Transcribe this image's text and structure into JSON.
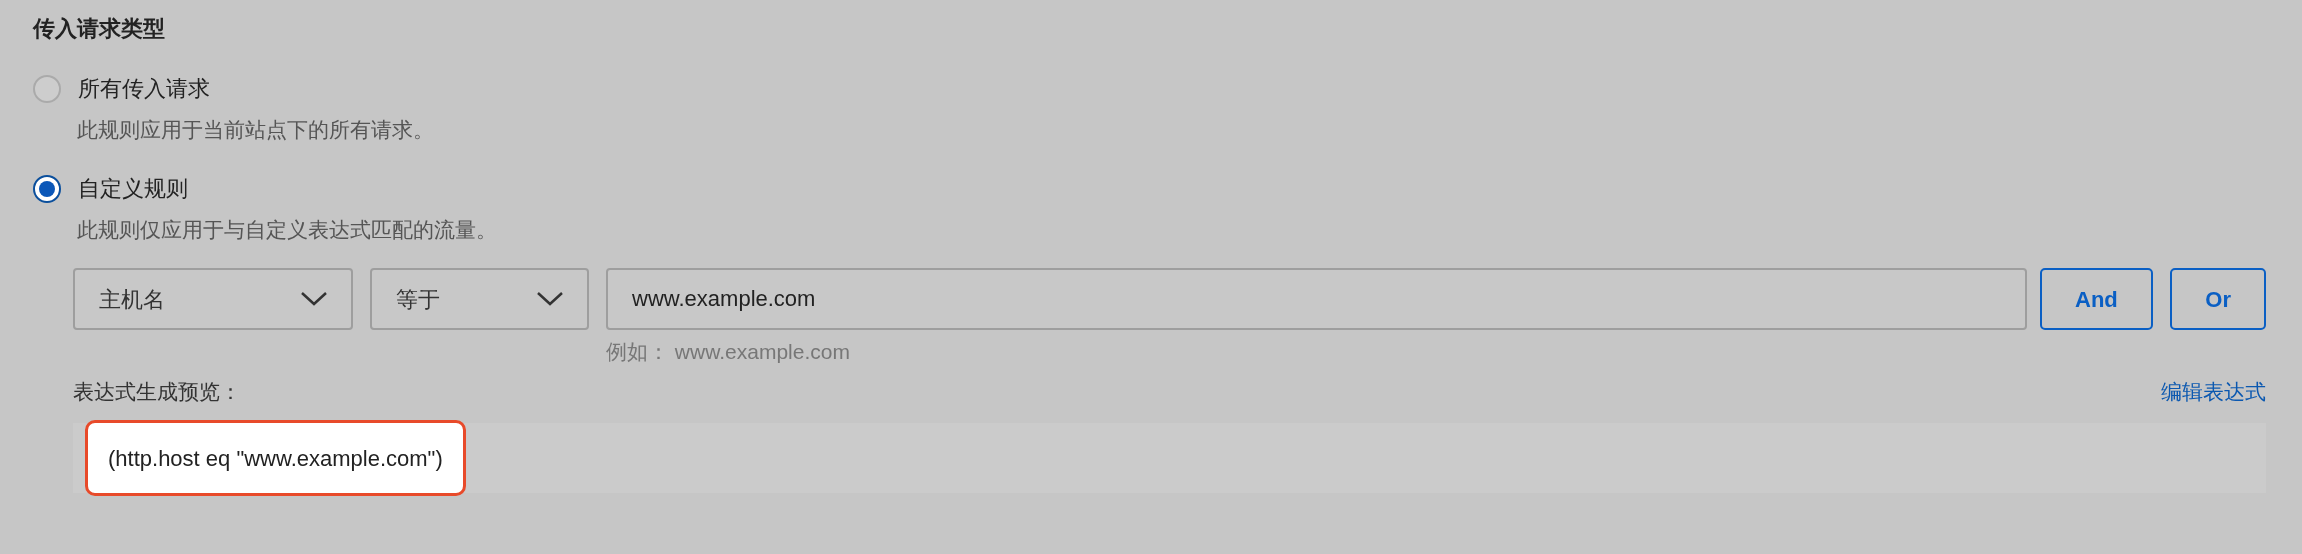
{
  "section_title": "传入请求类型",
  "options": [
    {
      "label": "所有传入请求",
      "description": "此规则应用于当前站点下的所有请求。",
      "selected": false
    },
    {
      "label": "自定义规则",
      "description": "此规则仅应用于与自定义表达式匹配的流量。",
      "selected": true
    }
  ],
  "rule": {
    "field": "主机名",
    "operator": "等于",
    "value": "www.example.com",
    "hint": "例如： www.example.com",
    "buttons": [
      "And",
      "Or"
    ]
  },
  "preview": {
    "label": "表达式生成预览：",
    "edit_link": "编辑表达式",
    "expression": "(http.host eq \"www.example.com\")",
    "highlighted": true
  }
}
